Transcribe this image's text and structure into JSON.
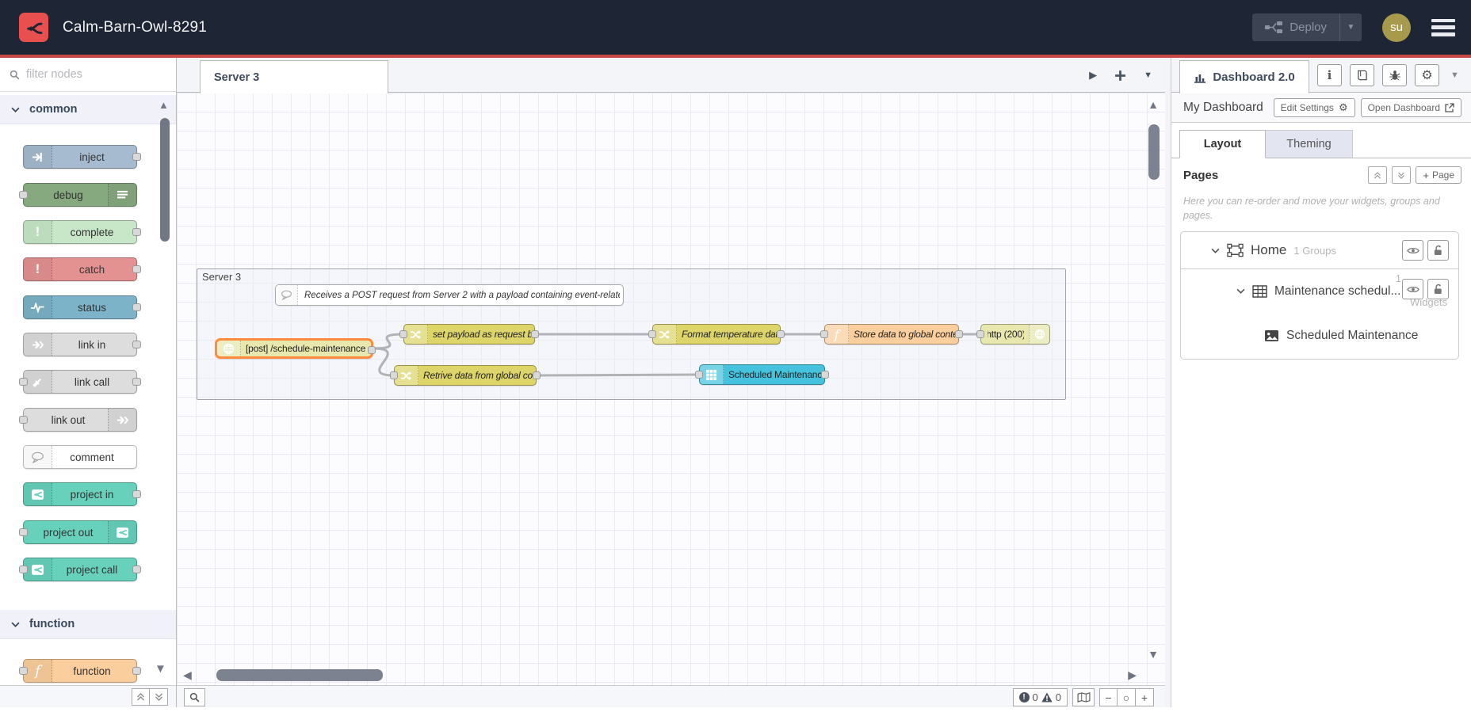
{
  "colors": {
    "accent_red": "#c94747",
    "header_bg": "#1e2636",
    "selection_orange": "#ff8a3c",
    "node_http": "#e7e7ae",
    "node_change": "#ddd56a",
    "node_function": "#fbcf9d",
    "node_widget": "#45c3de"
  },
  "header": {
    "title": "Calm-Barn-Owl-8291",
    "deploy_label": "Deploy",
    "avatar_initials": "su"
  },
  "palette": {
    "filter_placeholder": "filter nodes",
    "categories": [
      {
        "label": "common",
        "nodes": [
          {
            "label": "inject"
          },
          {
            "label": "debug"
          },
          {
            "label": "complete"
          },
          {
            "label": "catch"
          },
          {
            "label": "status"
          },
          {
            "label": "link in"
          },
          {
            "label": "link call"
          },
          {
            "label": "link out"
          },
          {
            "label": "comment"
          },
          {
            "label": "project in"
          },
          {
            "label": "project out"
          },
          {
            "label": "project call"
          }
        ]
      },
      {
        "label": "function",
        "nodes": [
          {
            "label": "function"
          }
        ]
      }
    ]
  },
  "workspace": {
    "tab_label": "Server 3",
    "group_label": "Server 3",
    "comment_text": "Receives a POST request from Server 2 with a payload containing event-related data.",
    "nodes": [
      {
        "label": "[post] /schedule-maintenance"
      },
      {
        "label": "set payload as request body"
      },
      {
        "label": "Retrive data from global context"
      },
      {
        "label": "Format temperature data."
      },
      {
        "label": "Store data to global context"
      },
      {
        "label": "http (200)"
      },
      {
        "label": "Scheduled Maintenance"
      }
    ],
    "status_bar": {
      "error_count": "0",
      "warning_count": "0"
    }
  },
  "sidebar": {
    "tab_label": "Dashboard 2.0",
    "dashboard_name": "My Dashboard",
    "edit_settings_label": "Edit Settings",
    "open_dashboard_label": "Open Dashboard",
    "tabs": [
      {
        "label": "Layout"
      },
      {
        "label": "Theming"
      }
    ],
    "pages_title": "Pages",
    "add_page_label": "Page",
    "help_text": "Here you can re-order and move your widgets, groups and pages.",
    "tree": {
      "page_label": "Home",
      "page_meta": "1 Groups",
      "group_label": "Maintenance schedul...",
      "group_meta_count": "1",
      "group_meta_word": "Widgets",
      "widget_label": "Scheduled Maintenance"
    }
  }
}
